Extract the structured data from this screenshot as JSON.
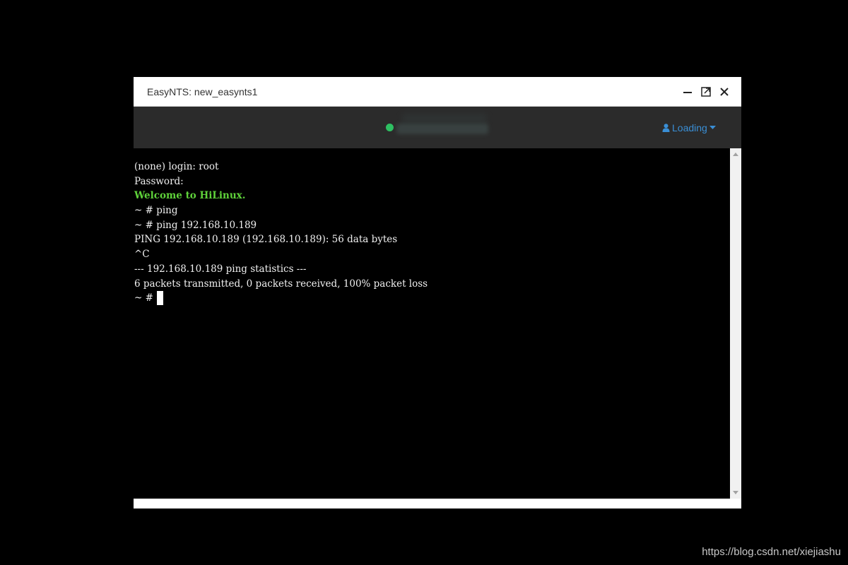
{
  "window": {
    "title": "EasyNTS: new_easynts1"
  },
  "toolbar": {
    "status_color": "#2ec062",
    "user_icon": "user-icon",
    "user_label": "Loading",
    "dropdown_icon": "caret-down-icon",
    "accent_color": "#3a8fd6"
  },
  "terminal": {
    "lines": [
      "(none) login: root",
      "Password:",
      "Welcome to HiLinux.",
      "~ # ping",
      "~ # ping 192.168.10.189",
      "PING 192.168.10.189 (192.168.10.189): 56 data bytes",
      "^C",
      "--- 192.168.10.189 ping statistics ---",
      "6 packets transmitted, 0 packets received, 100% packet loss"
    ],
    "prompt": "~ #"
  },
  "watermark": "https://blog.csdn.net/xiejiashu"
}
